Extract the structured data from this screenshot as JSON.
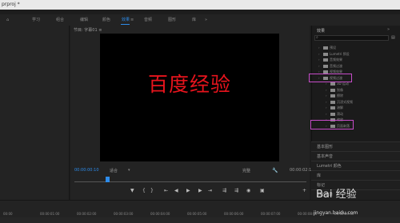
{
  "window": {
    "title": "prproj *"
  },
  "workspaces": {
    "items": [
      "学习",
      "组合",
      "编辑",
      "颜色",
      "效果",
      "音频",
      "图形",
      "库"
    ],
    "active": "效果"
  },
  "monitor": {
    "tab": "节目: 字幕01 ≡",
    "overlay_text": "百度经验",
    "timecode_left": "00:00:00:10",
    "fit_label": "适合",
    "quality_label": "完整",
    "timecode_right": "00:00:02:18"
  },
  "effects": {
    "title": "效果",
    "tree": [
      {
        "label": "预设",
        "level": 0
      },
      {
        "label": "Lumetri 预设",
        "level": 0
      },
      {
        "label": "音频效果",
        "level": 0
      },
      {
        "label": "音频过渡",
        "level": 0
      },
      {
        "label": "视频效果",
        "level": 0
      },
      {
        "label": "视频过渡",
        "level": 0
      },
      {
        "label": "3D 运动",
        "level": 1
      },
      {
        "label": "划像",
        "level": 1
      },
      {
        "label": "擦除",
        "level": 1
      },
      {
        "label": "沉浸式视频",
        "level": 1
      },
      {
        "label": "溶解",
        "level": 1
      },
      {
        "label": "滑动",
        "level": 1
      },
      {
        "label": "缩放",
        "level": 1
      },
      {
        "label": "页面剥落",
        "level": 1
      }
    ],
    "highlighted": [
      "视频过渡",
      "页面剥落"
    ]
  },
  "sections": [
    "基本图形",
    "基本声音",
    "Lumetri 颜色",
    "库",
    "标记",
    "历史记录"
  ],
  "timeline": {
    "ticks": [
      "00:00",
      "00:00:01:00",
      "00:00:02:00",
      "00:00:03:00",
      "00:00:04:00",
      "00:00:05:00",
      "00:00:06:00",
      "00:00:07:00",
      "00:00:08:00",
      "00:00:09:00"
    ]
  },
  "watermark": {
    "brand": "Bai 经验",
    "url": "jingyan.baidu.com"
  },
  "colors": {
    "accent": "#2d8ceb",
    "highlight": "#c64cc8",
    "title_text": "#e8141d"
  }
}
